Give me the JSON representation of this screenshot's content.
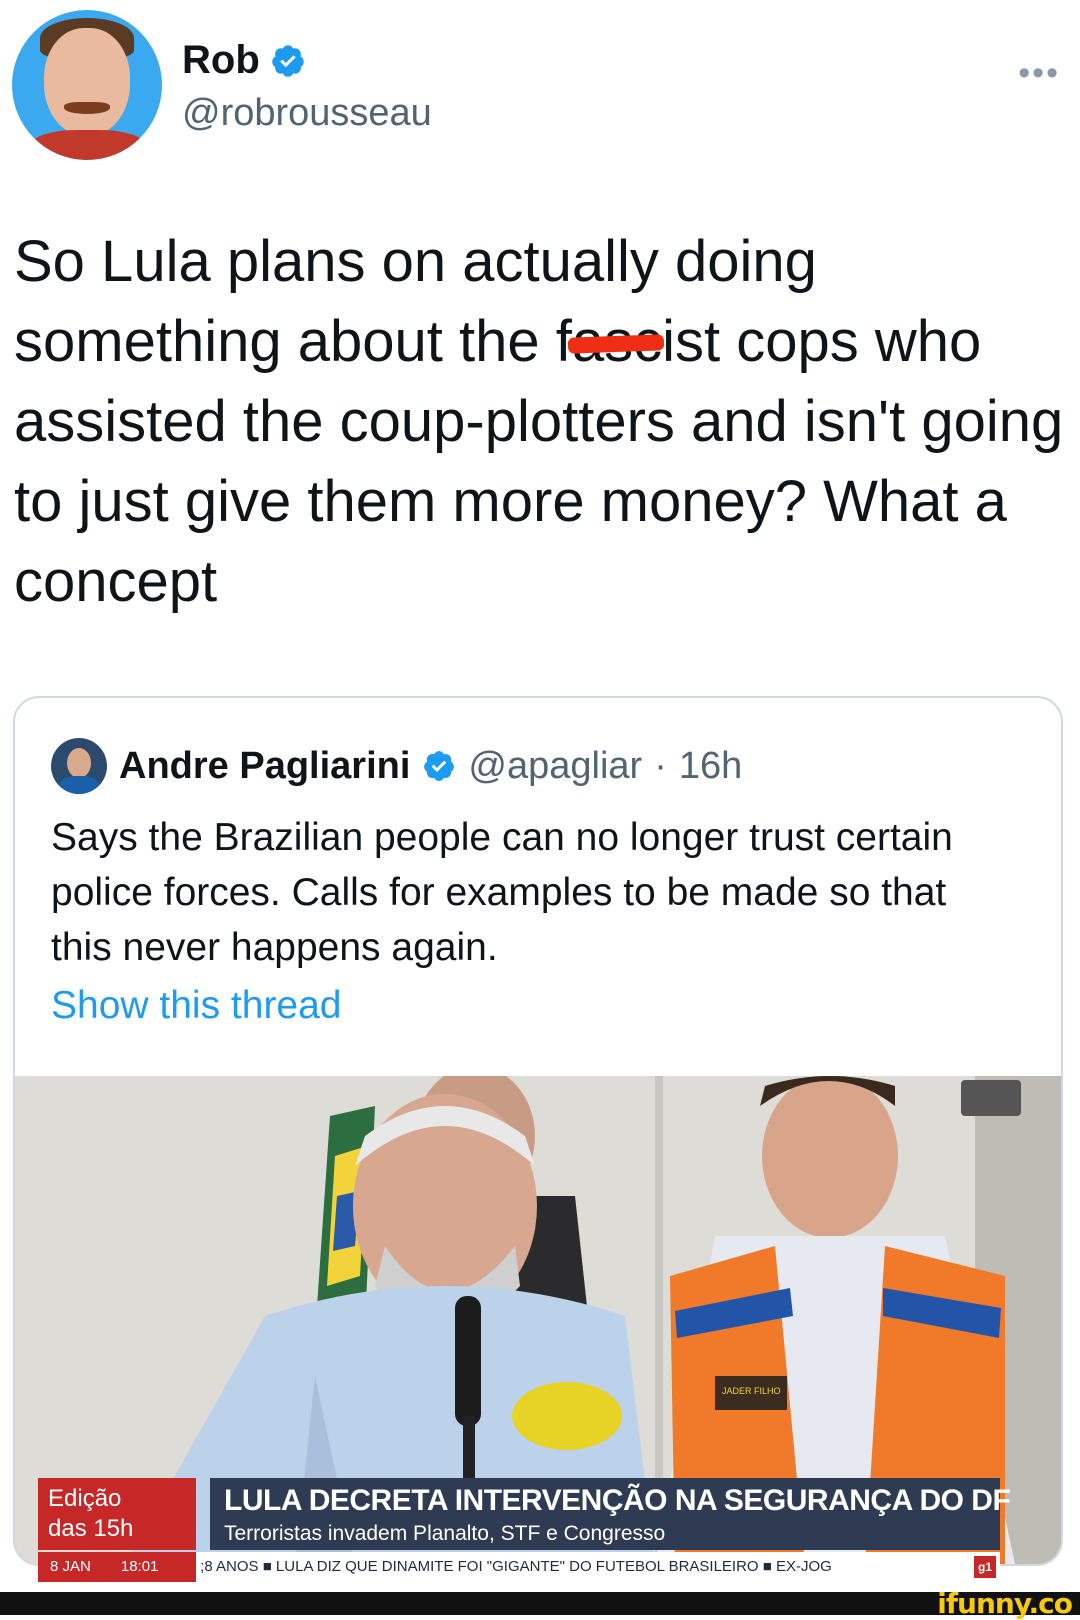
{
  "tweet": {
    "author_name": "Rob",
    "author_handle": "@robrousseau",
    "more_label": "•••",
    "text_before": "So Lula plans on actually doing something about the ",
    "redacted_word": "fascist",
    "text_after": " cops who assisted the coup-plotters and isn't going to just give them more money? What a concept"
  },
  "quote": {
    "author_name": "Andre Pagliarini",
    "author_handle": "@apagliar",
    "separator": "·",
    "time_ago": "16h",
    "text": "Says the Brazilian people can no longer trust certain police forces. Calls for examples to be made so that this never happens again.",
    "show_thread_label": "Show this thread"
  },
  "broadcast": {
    "program_line1": "Edição",
    "program_line2": "das 15h",
    "headline": "LULA DECRETA INTERVENÇÃO NA SEGURANÇA DO DF",
    "subheadline": "Terroristas invadem Planalto, STF e Congresso",
    "date": "8 JAN",
    "time": "18:01",
    "ticker": ";8 ANOS  ■  LULA DIZ QUE DINAMITE FOI \"GIGANTE\" DO FUTEBOL BRASILEIRO  ■  EX-JOG",
    "channel_badge": "g1",
    "vest_label": "JADER FILHO"
  },
  "watermark": "ifunny.co",
  "colors": {
    "link": "#1d9bf0",
    "verified": "#1d9bf0",
    "redaction": "#f02e16",
    "news_red": "#c62828",
    "news_navy": "#2f3b52",
    "watermark": "#f6c90e"
  }
}
